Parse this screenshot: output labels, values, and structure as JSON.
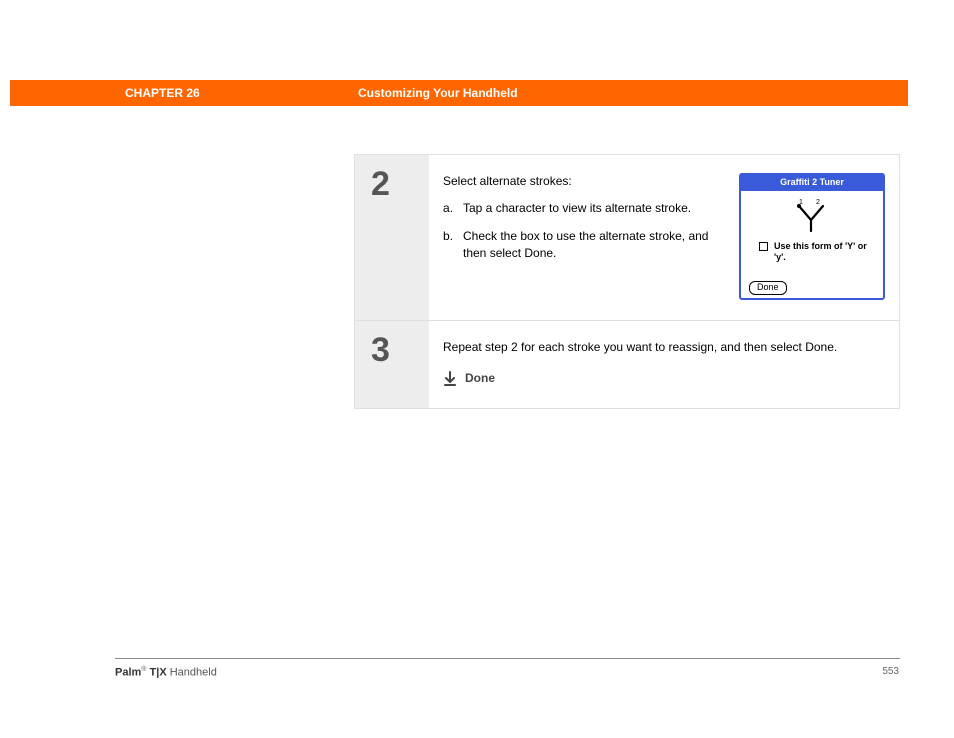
{
  "header": {
    "chapter": "CHAPTER 26",
    "title": "Customizing Your Handheld"
  },
  "steps": [
    {
      "number": "2",
      "intro": "Select alternate strokes:",
      "items": [
        {
          "letter": "a.",
          "text": "Tap a character to view its alternate stroke."
        },
        {
          "letter": "b.",
          "text": "Check the box to use the alternate stroke, and then select Done."
        }
      ],
      "tuner": {
        "title": "Graffiti 2 Tuner",
        "label_nums": [
          "1",
          "2"
        ],
        "checkbox_label": "Use this form of 'Y' or 'y'.",
        "done_label": "Done"
      }
    },
    {
      "number": "3",
      "text": "Repeat step 2 for each stroke you want to reassign, and then select Done.",
      "done_marker": "Done"
    }
  ],
  "footer": {
    "brand": "Palm",
    "reg": "®",
    "model": " T|X",
    "suffix": " Handheld",
    "page": "553"
  }
}
